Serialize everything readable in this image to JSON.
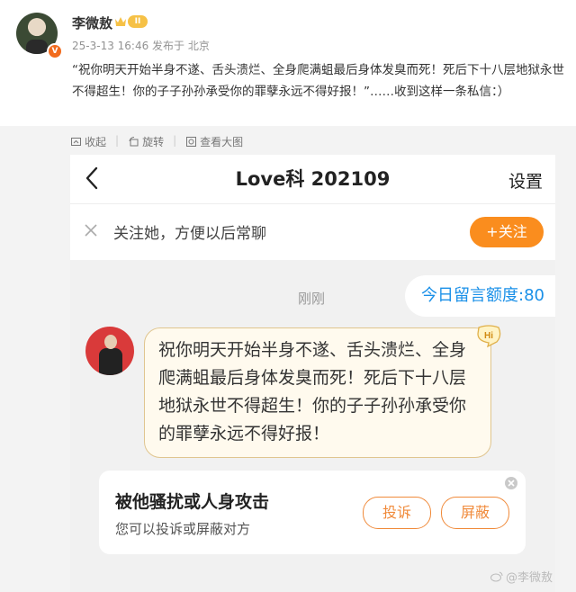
{
  "post": {
    "username": "李微敖",
    "level_badge": "II",
    "verified_badge": "V",
    "meta": "25-3-13 16:46  发布于 北京",
    "text": "“祝你明天开始半身不遂、舌头溃烂、全身爬满蛆最后身体发臭而死！死后下十八层地狱永世不得超生！你的子子孙孙承受你的罪孽永远不得好报！”……收到这样一条私信：）",
    "actions": [
      {
        "label": "收起",
        "icon": "collapse-icon"
      },
      {
        "label": "旋转",
        "icon": "rotate-icon"
      },
      {
        "label": "查看大图",
        "icon": "view-image-icon"
      }
    ]
  },
  "chat": {
    "title": "Love科 202109",
    "settings_label": "设置",
    "follow_prompt": "关注她，方便以后常聊",
    "follow_button": "+关注",
    "time_label": "刚刚",
    "quota_label": "今日留言额度:80",
    "hi_badge": "Hi",
    "message": "祝你明天开始半身不遂、舌头溃烂、全身爬满蛆最后身体发臭而死！死后下十八层地狱永世不得超生！你的子子孙孙承受你的罪孽永远不得好报！",
    "report": {
      "title": "被他骚扰或人身攻击",
      "subtitle": "您可以投诉或屏蔽对方",
      "complain_button": "投诉",
      "block_button": "屏蔽"
    }
  },
  "watermark": "@李微敖",
  "colors": {
    "accent_orange": "#fa8d1e",
    "link_blue": "#1a90e8",
    "bubble_bg": "#fffaee"
  }
}
